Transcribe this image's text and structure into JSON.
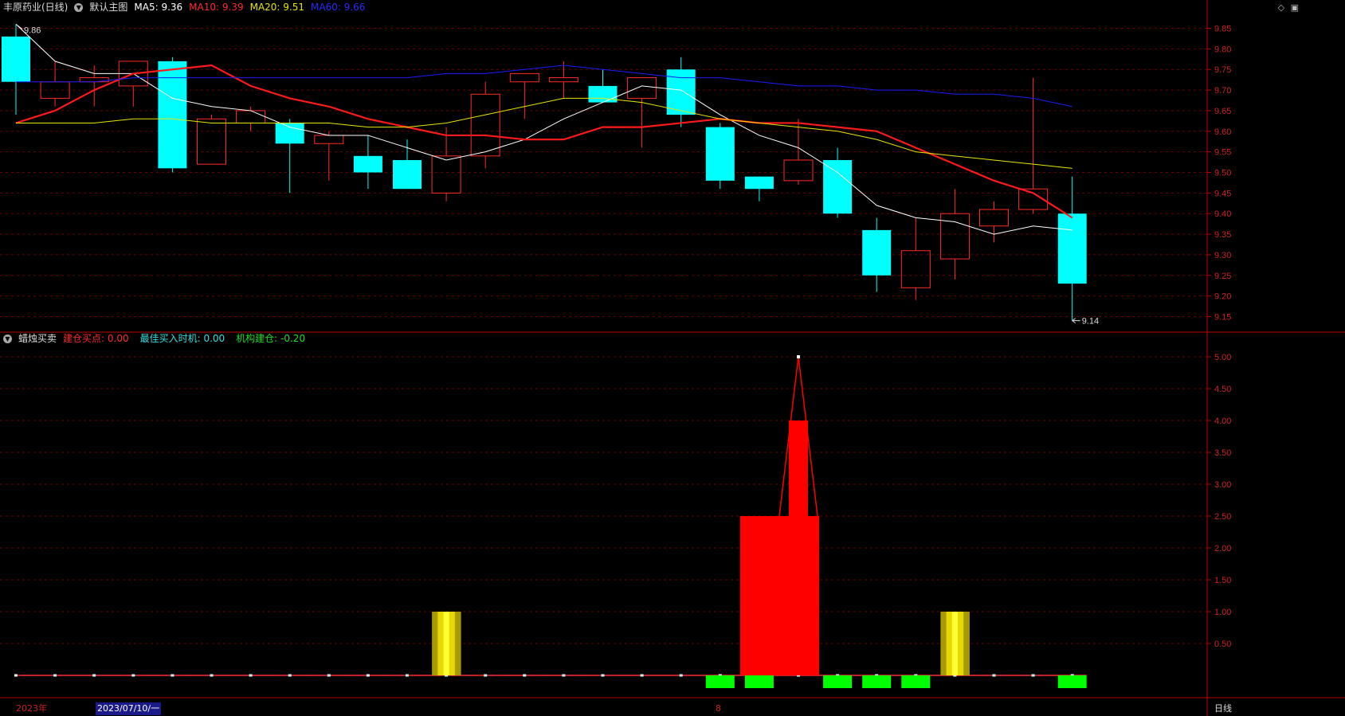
{
  "header": {
    "stock_title": "丰原药业(日线)",
    "template_label": "默认主图",
    "ma": [
      {
        "label": "MA5: 9.36",
        "color": "#ffffff"
      },
      {
        "label": "MA10: 9.39",
        "color": "#ff2a2a"
      },
      {
        "label": "MA20: 9.51",
        "color": "#e6e600"
      },
      {
        "label": "MA60: 9.66",
        "color": "#2a2aff"
      }
    ]
  },
  "indicator_header": {
    "name": "蜡烛买卖",
    "items": [
      {
        "label": "建仓买点: 0.00",
        "color": "#ff2a2a"
      },
      {
        "label": "最佳买入时机: 0.00",
        "color": "#33e0e0"
      },
      {
        "label": "机构建仓: -0.20",
        "color": "#22dd22"
      }
    ]
  },
  "annotations": {
    "high": "9.86",
    "low": "9.14"
  },
  "timebar": {
    "year": "2023年",
    "cursor_date": "2023/07/10/一",
    "mark": "8",
    "period": "日线"
  },
  "colors": {
    "up": "#ff2a2a",
    "down": "#00ffff",
    "grid": "#6a0000",
    "axis": "#bb0000",
    "ma5": "#ffffff",
    "ma10": "#ff1a1a",
    "ma20": "#e6e600",
    "ma60": "#1a1aff"
  },
  "chart_data": [
    {
      "type": "candlestick",
      "ylim": [
        9.12,
        9.88
      ],
      "yticks": [
        "9.85",
        "9.80",
        "9.75",
        "9.70",
        "9.65",
        "9.60",
        "9.55",
        "9.50",
        "9.45",
        "9.40",
        "9.35",
        "9.30",
        "9.25",
        "9.20",
        "9.15"
      ],
      "candles": [
        {
          "o": 9.83,
          "h": 9.86,
          "l": 9.64,
          "c": 9.72
        },
        {
          "o": 9.68,
          "h": 9.77,
          "l": 9.66,
          "c": 9.72
        },
        {
          "o": 9.72,
          "h": 9.76,
          "l": 9.66,
          "c": 9.73
        },
        {
          "o": 9.71,
          "h": 9.77,
          "l": 9.66,
          "c": 9.77
        },
        {
          "o": 9.77,
          "h": 9.78,
          "l": 9.5,
          "c": 9.51
        },
        {
          "o": 9.52,
          "h": 9.64,
          "l": 9.52,
          "c": 9.63
        },
        {
          "o": 9.62,
          "h": 9.66,
          "l": 9.6,
          "c": 9.65
        },
        {
          "o": 9.62,
          "h": 9.63,
          "l": 9.45,
          "c": 9.57
        },
        {
          "o": 9.57,
          "h": 9.6,
          "l": 9.48,
          "c": 9.59
        },
        {
          "o": 9.54,
          "h": 9.59,
          "l": 9.46,
          "c": 9.5
        },
        {
          "o": 9.53,
          "h": 9.58,
          "l": 9.46,
          "c": 9.46
        },
        {
          "o": 9.45,
          "h": 9.61,
          "l": 9.43,
          "c": 9.54
        },
        {
          "o": 9.54,
          "h": 9.72,
          "l": 9.51,
          "c": 9.69
        },
        {
          "o": 9.72,
          "h": 9.74,
          "l": 9.63,
          "c": 9.74
        },
        {
          "o": 9.72,
          "h": 9.77,
          "l": 9.68,
          "c": 9.73
        },
        {
          "o": 9.71,
          "h": 9.75,
          "l": 9.67,
          "c": 9.67
        },
        {
          "o": 9.68,
          "h": 9.73,
          "l": 9.56,
          "c": 9.73
        },
        {
          "o": 9.75,
          "h": 9.78,
          "l": 9.61,
          "c": 9.64
        },
        {
          "o": 9.61,
          "h": 9.62,
          "l": 9.46,
          "c": 9.48
        },
        {
          "o": 9.49,
          "h": 9.49,
          "l": 9.43,
          "c": 9.46
        },
        {
          "o": 9.48,
          "h": 9.63,
          "l": 9.47,
          "c": 9.53
        },
        {
          "o": 9.53,
          "h": 9.56,
          "l": 9.39,
          "c": 9.4
        },
        {
          "o": 9.36,
          "h": 9.39,
          "l": 9.21,
          "c": 9.25
        },
        {
          "o": 9.22,
          "h": 9.39,
          "l": 9.19,
          "c": 9.31
        },
        {
          "o": 9.29,
          "h": 9.46,
          "l": 9.24,
          "c": 9.4
        },
        {
          "o": 9.37,
          "h": 9.43,
          "l": 9.33,
          "c": 9.41
        },
        {
          "o": 9.41,
          "h": 9.73,
          "l": 9.4,
          "c": 9.46
        },
        {
          "o": 9.4,
          "h": 9.49,
          "l": 9.14,
          "c": 9.23
        }
      ],
      "series": [
        {
          "name": "MA5",
          "values": [
            9.86,
            9.77,
            9.74,
            9.74,
            9.68,
            9.66,
            9.65,
            9.61,
            9.59,
            9.59,
            9.56,
            9.53,
            9.55,
            9.58,
            9.63,
            9.67,
            9.71,
            9.7,
            9.64,
            9.59,
            9.56,
            9.5,
            9.42,
            9.39,
            9.38,
            9.35,
            9.37,
            9.36
          ]
        },
        {
          "name": "MA10",
          "values": [
            9.62,
            9.65,
            9.7,
            9.74,
            9.75,
            9.76,
            9.71,
            9.68,
            9.66,
            9.63,
            9.61,
            9.59,
            9.59,
            9.58,
            9.58,
            9.61,
            9.61,
            9.62,
            9.63,
            9.62,
            9.62,
            9.61,
            9.6,
            9.56,
            9.52,
            9.48,
            9.45,
            9.39
          ]
        },
        {
          "name": "MA20",
          "values": [
            9.62,
            9.62,
            9.62,
            9.63,
            9.63,
            9.62,
            9.62,
            9.62,
            9.62,
            9.61,
            9.61,
            9.62,
            9.64,
            9.66,
            9.68,
            9.68,
            9.67,
            9.65,
            9.63,
            9.62,
            9.61,
            9.6,
            9.58,
            9.55,
            9.54,
            9.53,
            9.52,
            9.51
          ]
        },
        {
          "name": "MA60",
          "values": [
            9.72,
            9.72,
            9.72,
            9.73,
            9.73,
            9.73,
            9.73,
            9.73,
            9.73,
            9.73,
            9.73,
            9.74,
            9.74,
            9.75,
            9.76,
            9.75,
            9.74,
            9.73,
            9.73,
            9.72,
            9.71,
            9.71,
            9.7,
            9.7,
            9.69,
            9.69,
            9.68,
            9.66
          ]
        }
      ]
    },
    {
      "type": "bar",
      "ylim": [
        -0.25,
        5.2
      ],
      "yticks": [
        "5.00",
        "4.50",
        "4.00",
        "3.50",
        "3.00",
        "2.50",
        "2.00",
        "1.50",
        "1.00",
        "0.50"
      ],
      "series": [
        {
          "name": "建仓买点",
          "values": [
            0,
            0,
            0,
            0,
            0,
            0,
            0,
            0,
            0,
            0,
            0,
            0,
            0,
            0,
            0,
            0,
            0,
            0,
            0,
            2.5,
            2.5,
            0,
            0,
            0,
            0,
            0,
            0,
            0
          ]
        },
        {
          "name": "最佳买入时机",
          "values": [
            0,
            0,
            0,
            0,
            0,
            0,
            0,
            0,
            0,
            0,
            0,
            1,
            0,
            0,
            0,
            0,
            0,
            0,
            0,
            0,
            0,
            0,
            0,
            0,
            1,
            0,
            0,
            0
          ]
        },
        {
          "name": "机构建仓",
          "values": [
            0,
            0,
            0,
            0,
            0,
            0,
            0,
            0,
            0,
            0,
            0,
            0,
            0,
            0,
            0,
            0,
            0,
            0,
            -0.2,
            -0.2,
            0,
            -0.2,
            -0.2,
            -0.2,
            0,
            0,
            0,
            -0.2
          ]
        },
        {
          "name": "peak",
          "values": [
            0,
            0,
            0,
            0,
            0,
            0,
            0,
            0,
            0,
            0,
            0,
            0,
            0,
            0,
            0,
            0,
            0,
            0,
            0,
            0,
            4.0,
            0,
            0,
            0,
            0,
            0,
            0,
            0
          ]
        },
        {
          "name": "signal_line",
          "values": [
            0,
            0,
            0,
            0,
            0,
            0,
            0,
            0,
            0,
            0,
            0,
            0,
            0,
            0,
            0,
            0,
            0,
            0,
            0,
            0,
            5.0,
            0,
            0,
            0,
            0,
            0,
            0,
            0
          ]
        }
      ]
    }
  ]
}
